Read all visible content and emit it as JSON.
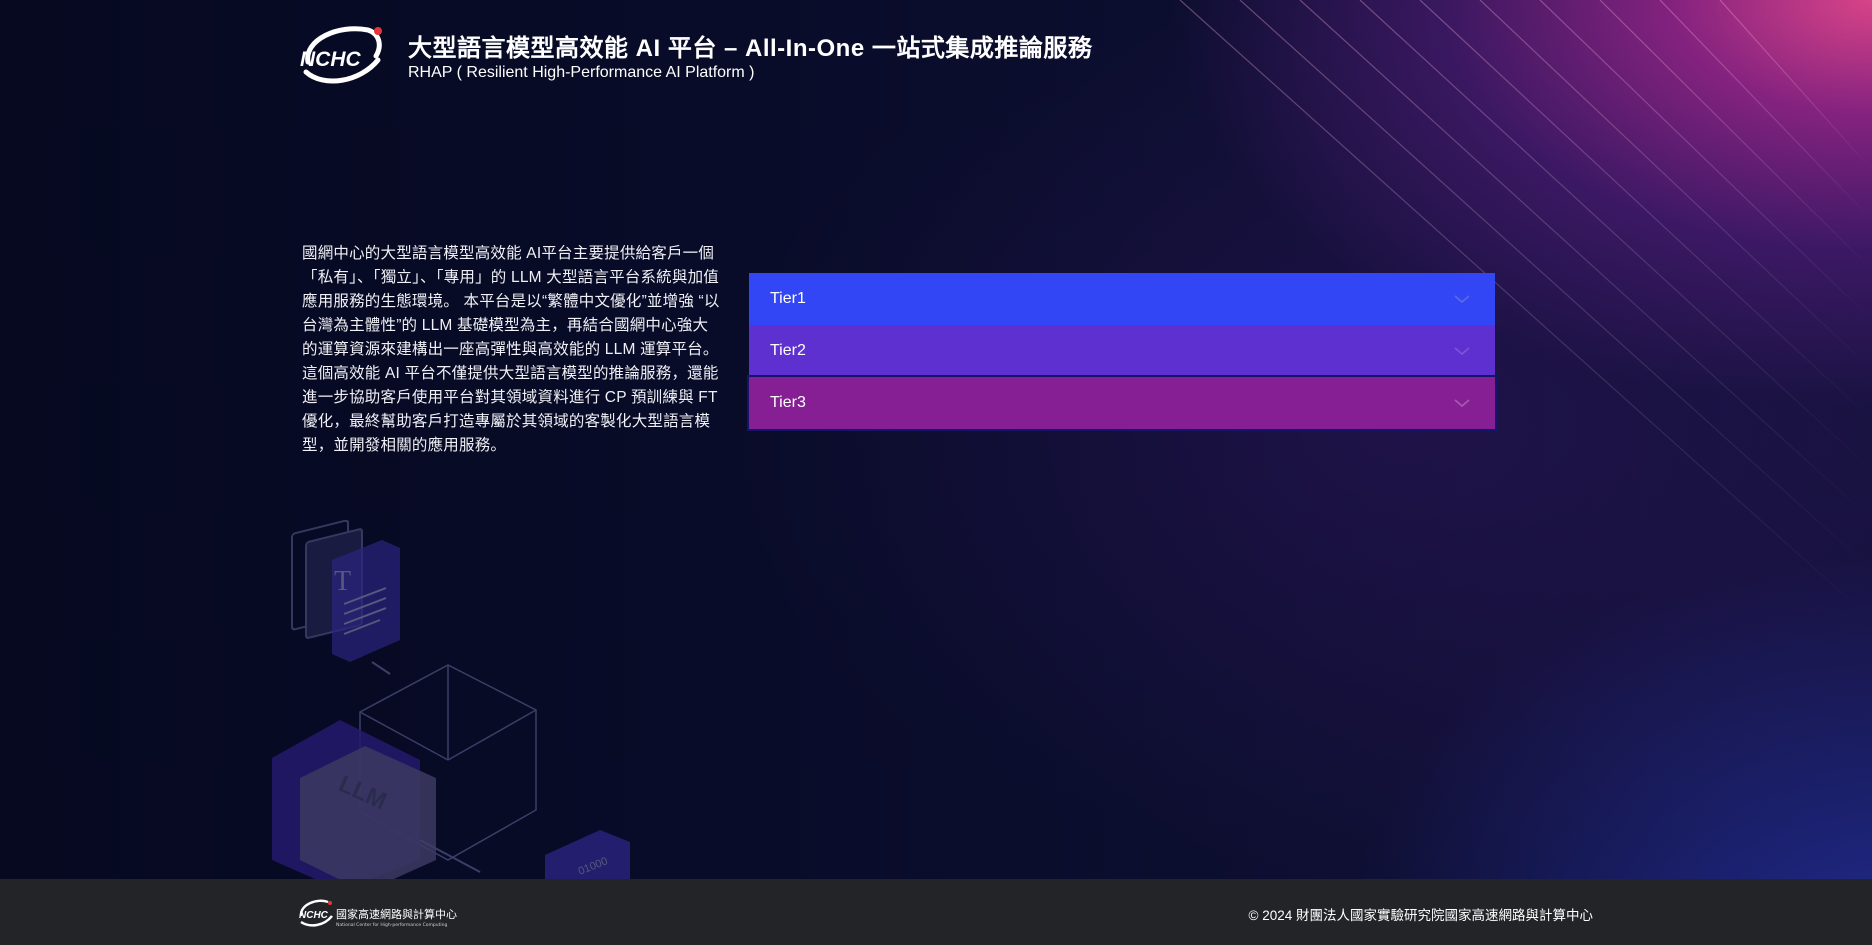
{
  "header": {
    "title": "大型語言模型高效能 AI 平台 – All-In-One 一站式集成推論服務",
    "subtitle": "RHAP ( Resilient High-Performance AI Platform )",
    "logo_text": "NCHC"
  },
  "intro": {
    "text": "國網中心的大型語言模型高效能 AI平台主要提供給客戶一個「私有」、「獨立」、「專用」的 LLM 大型語言平台系統與加值應用服務的生態環境。 本平台是以“繁體中文優化”並增強 “以台灣為主體性”的 LLM 基礎模型為主，再結合國網中心強大的運算資源來建構出一座高彈性與高效能的 LLM 運算平台。 這個高效能 AI 平台不僅提供大型語言模型的推論服務，還能進一步協助客戶使用平台對其領域資料進行 CP 預訓練與 FT 優化，最終幫助客戶打造專屬於其領域的客製化大型語言模型，並開發相關的應用服務。"
  },
  "tiers": [
    {
      "label": "Tier1",
      "color": "#3346f5",
      "icon": "chevron-down-icon"
    },
    {
      "label": "Tier2",
      "color": "#5e30d0",
      "icon": "chevron-down-icon"
    },
    {
      "label": "Tier3",
      "color": "#861f93",
      "icon": "chevron-down-icon"
    }
  ],
  "illustration": {
    "doc_letter": "T",
    "cube_label": "LLM",
    "box_label": "01000"
  },
  "footer": {
    "logo_lines": [
      "國家高速網路與計算中心",
      "National Center for High-performance Computing"
    ],
    "copyright": "© 2024 財團法人國家實驗研究院國家高速網路與計算中心"
  }
}
